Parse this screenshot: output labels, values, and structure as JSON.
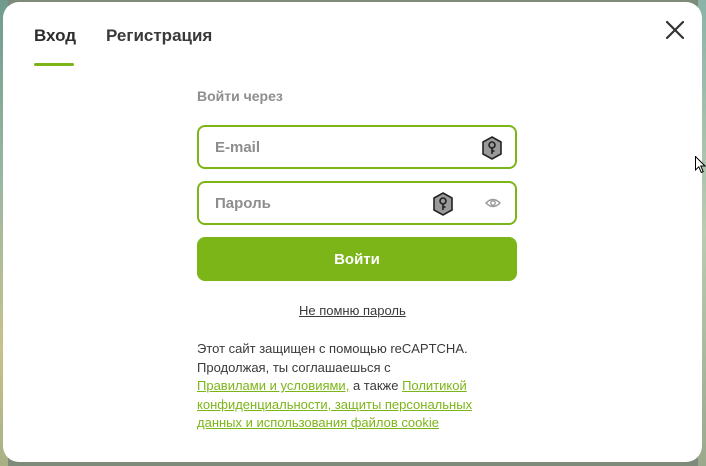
{
  "tabs": {
    "login_label": "Вход",
    "register_label": "Регистрация"
  },
  "login_form": {
    "section_label": "Войти через",
    "email_placeholder": "E-mail",
    "password_placeholder": "Пароль",
    "submit_label": "Войти",
    "forgot_password_label": "Не помню пароль"
  },
  "recaptcha": {
    "line1": "Этот сайт защищен с помощью reCAPTCHA.",
    "line2_prefix": "Продолжая, ты соглашаешься с",
    "terms_link": "Правилами и условиями,",
    "and_also": "а также",
    "privacy_link": "Политикой конфиденциальности, защиты персональных данных и использования файлов cookie"
  },
  "icons": {
    "close": "close-icon",
    "key": "key-icon",
    "eye": "eye-icon"
  },
  "colors": {
    "accent": "#7cb518",
    "text": "#3a3a3a",
    "muted": "#8e8e8e"
  }
}
